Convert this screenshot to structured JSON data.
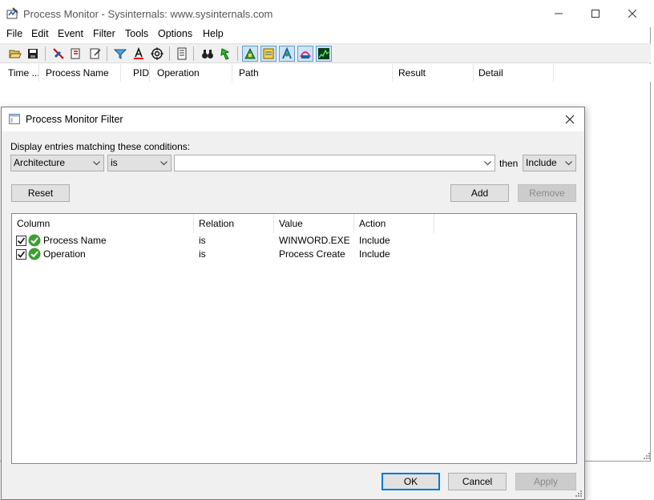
{
  "main_window": {
    "title": "Process Monitor - Sysinternals: www.sysinternals.com",
    "menu": [
      "File",
      "Edit",
      "Event",
      "Filter",
      "Tools",
      "Options",
      "Help"
    ],
    "columns": [
      "Time ...",
      "Process Name",
      "PID",
      "Operation",
      "Path",
      "Result",
      "Detail"
    ]
  },
  "filter_dialog": {
    "title": "Process Monitor Filter",
    "conditions_label": "Display entries matching these conditions:",
    "column_select": "Architecture",
    "relation_select": "is",
    "value_input": "",
    "then_label": "then",
    "action_select": "Include",
    "reset_label": "Reset",
    "add_label": "Add",
    "remove_label": "Remove",
    "list_headers": [
      "Column",
      "Relation",
      "Value",
      "Action"
    ],
    "rules": [
      {
        "column": "Process Name",
        "relation": "is",
        "value": "WINWORD.EXE",
        "action": "Include",
        "checked": true
      },
      {
        "column": "Operation",
        "relation": "is",
        "value": "Process Create",
        "action": "Include",
        "checked": true
      }
    ],
    "ok_label": "OK",
    "cancel_label": "Cancel",
    "apply_label": "Apply"
  },
  "colors": {
    "accent": "#0078d7",
    "check_green": "#3aa12f",
    "pressed_bg": "#cce4f7"
  }
}
